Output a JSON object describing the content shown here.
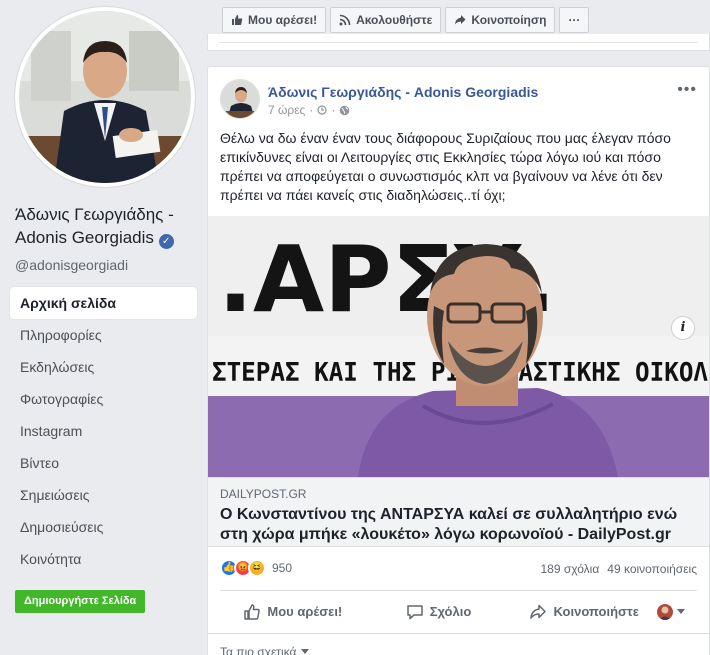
{
  "left": {
    "page_name": "Άδωνις Γεωργιάδης - Adonis Georgiadis",
    "handle": "@adonisgeorgiadi",
    "nav": [
      {
        "label": "Αρχική σελίδα",
        "active": true
      },
      {
        "label": "Πληροφορίες"
      },
      {
        "label": "Εκδηλώσεις"
      },
      {
        "label": "Φωτογραφίες"
      },
      {
        "label": "Instagram"
      },
      {
        "label": "Βίντεο"
      },
      {
        "label": "Σημειώσεις"
      },
      {
        "label": "Δημοσιεύσεις"
      },
      {
        "label": "Κοινότητα"
      }
    ],
    "create_page_label": "Δημιουργήστε Σελίδα"
  },
  "topbar": {
    "like_label": "Μου αρέσει!",
    "follow_label": "Ακολουθήστε",
    "share_label": "Κοινοποίηση",
    "more_label": "···"
  },
  "post": {
    "author": "Άδωνις Γεωργιάδης - Adonis Georgiadis",
    "time": "7 ώρες",
    "text": "Θέλω να δω έναν έναν τους διάφορους Συριζαίους που μας έλεγαν πόσο επικίνδυνες είναι οι Λειτουργίες στις Εκκλησίες τώρα λόγω ιού και πόσο πρέπει να αποφεύγεται ο συνωστισμός κλπ να βγαίνουν να λένε ότι δεν πρέπει να πάει κανείς στις διαδηλώσεις..τί όχι;",
    "image_banner_top": ".ΑΡΣΥ.",
    "image_banner_bottom": "ΣΤΕΡΑΣ ΚΑΙ ΤΗΣ ΡΙΖΟΣΠΑΣΤΙΚΗΣ ΟΙΚΟΛ",
    "link": {
      "domain": "DAILYPOST.GR",
      "title": "Ο Κωνσταντίνου της ΑΝΤΑΡΣΥΑ καλεί σε συλλαλητήριο ενώ στη χώρα μπήκε «λουκέτο» λόγω κορωνοϊού - DailyPost.gr"
    },
    "reactions_count": "950",
    "comments": "189 σχόλια",
    "shares": "49 κοινοποιήσεις",
    "actions": {
      "like": "Μου αρέσει!",
      "comment": "Σχόλιο",
      "share": "Κοινοποιήστε"
    },
    "relevant_label": "Τα πιο σχετικά"
  },
  "colors": {
    "link_blue": "#385898",
    "fb_blue": "#4267b2",
    "create_green": "#42b72a",
    "banner_purple": "#8f6fb3"
  }
}
